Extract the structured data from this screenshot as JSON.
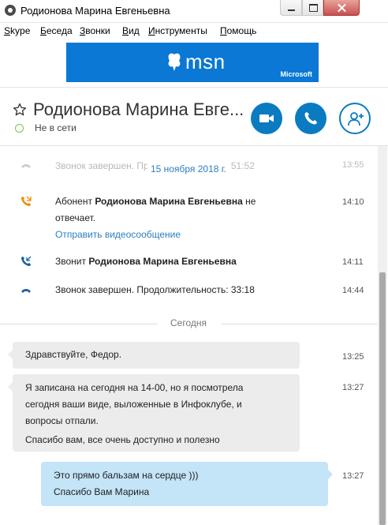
{
  "window": {
    "title": "Родионова Марина Евгеньевна"
  },
  "menu": [
    {
      "label": "Skype",
      "underline": "S",
      "rest": "kype"
    },
    {
      "label": "Беседа",
      "underline": "Б",
      "rest": "еседа"
    },
    {
      "label": "Звонки",
      "underline": "З",
      "rest": "вонки"
    },
    {
      "label": "Вид",
      "underline": "В",
      "rest": "ид"
    },
    {
      "label": "Инструменты",
      "underline": "И",
      "rest": "нструменты"
    },
    {
      "label": "Помощь",
      "underline": "П",
      "rest": "омощь"
    }
  ],
  "ad": {
    "brand": "msn",
    "vendor": "Microsoft",
    "color": "#0a78d4"
  },
  "contact": {
    "name": "Родионова Марина Евге...",
    "status": "Не в сети",
    "status_color": "#7dc242"
  },
  "actions": {
    "video_icon": "video-camera-icon",
    "call_icon": "phone-icon",
    "add_icon": "add-contact-icon",
    "accent": "#0a7bc1"
  },
  "history": {
    "faded_text": "Звонок завершен. Продолжительность: 51:52",
    "faded_time": "13:55",
    "date_label": "15 ноября 2018 г.",
    "events": [
      {
        "icon": "missed-call-icon",
        "prefix": "Абонент ",
        "name": "Родионова Марина Евгеньевна",
        "suffix": " не",
        "line2": "отвечает.",
        "link": "Отправить видеосообщение",
        "time": "14:10"
      },
      {
        "icon": "incoming-call-icon",
        "prefix": "Звонит ",
        "name": "Родионова Марина Евгеньевна",
        "time": "14:11"
      },
      {
        "icon": "call-ended-icon",
        "text": "Звонок завершен. Продолжительность: 33:18",
        "time": "14:44"
      }
    ]
  },
  "today_label": "Сегодня",
  "messages": [
    {
      "direction": "in",
      "lines": [
        "Здравствуйте, Федор."
      ],
      "time": "13:25"
    },
    {
      "direction": "in",
      "lines": [
        "Я записана на сегодня на 14-00, но я посмотрела",
        "сегодня ваши виде, выложенные в Инфоклубе, и",
        "вопросы отпали.",
        "Спасибо вам, все очень доступно и полезно"
      ],
      "time": "13:27"
    },
    {
      "direction": "out",
      "lines": [
        "Это прямо бальзам на сердце )))",
        "Спасибо Вам Марина"
      ],
      "time": "13:27"
    }
  ]
}
